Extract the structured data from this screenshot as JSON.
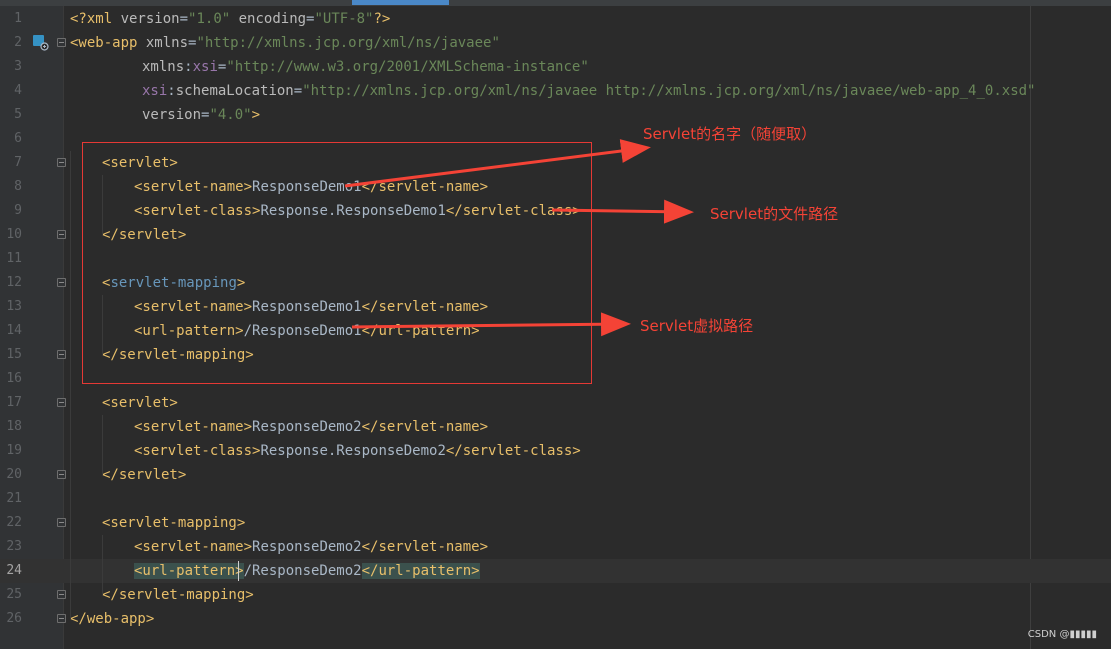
{
  "editor": {
    "current_line": 24,
    "lines": [
      {
        "n": "1",
        "tokens": [
          {
            "c": "t-tag",
            "t": "<?xml "
          },
          {
            "c": "t-attr",
            "t": "version"
          },
          {
            "c": "t-txt",
            "t": "="
          },
          {
            "c": "t-val",
            "t": "\"1.0\""
          },
          {
            "c": "t-attr",
            "t": " encoding"
          },
          {
            "c": "t-txt",
            "t": "="
          },
          {
            "c": "t-val",
            "t": "\"UTF-8\""
          },
          {
            "c": "t-tag",
            "t": "?>"
          }
        ]
      },
      {
        "n": "2",
        "tokens": [
          {
            "c": "t-tag",
            "t": "<web-app "
          },
          {
            "c": "t-attr",
            "t": "xmlns"
          },
          {
            "c": "t-txt",
            "t": "="
          },
          {
            "c": "t-val",
            "t": "\"http://xmlns.jcp.org/xml/ns/javaee\""
          }
        ]
      },
      {
        "n": "3",
        "tokens": [
          {
            "c": "t-attr",
            "t": "xmlns"
          },
          {
            "c": "t-txt",
            "t": ":"
          },
          {
            "c": "t-ns",
            "t": "xsi"
          },
          {
            "c": "t-txt",
            "t": "="
          },
          {
            "c": "t-val",
            "t": "\"http://www.w3.org/2001/XMLSchema-instance\""
          }
        ]
      },
      {
        "n": "4",
        "tokens": [
          {
            "c": "t-ns",
            "t": "xsi"
          },
          {
            "c": "t-txt",
            "t": ":"
          },
          {
            "c": "t-attr",
            "t": "schemaLocation"
          },
          {
            "c": "t-txt",
            "t": "="
          },
          {
            "c": "t-val",
            "t": "\"http://xmlns.jcp.org/xml/ns/javaee http://xmlns.jcp.org/xml/ns/javaee/web-app_4_0.xsd\""
          }
        ]
      },
      {
        "n": "5",
        "tokens": [
          {
            "c": "t-attr",
            "t": "version"
          },
          {
            "c": "t-txt",
            "t": "="
          },
          {
            "c": "t-val",
            "t": "\"4.0\""
          },
          {
            "c": "t-tag",
            "t": ">"
          }
        ]
      },
      {
        "n": "6",
        "tokens": []
      },
      {
        "n": "7",
        "tokens": [
          {
            "c": "t-tag",
            "t": "<servlet>"
          }
        ]
      },
      {
        "n": "8",
        "tokens": [
          {
            "c": "t-tag",
            "t": "<servlet-name>"
          },
          {
            "c": "t-txt",
            "t": "ResponseDemo1"
          },
          {
            "c": "t-tag",
            "t": "</servlet-name>"
          }
        ]
      },
      {
        "n": "9",
        "tokens": [
          {
            "c": "t-tag",
            "t": "<servlet-class>"
          },
          {
            "c": "t-txt",
            "t": "Response.ResponseDemo1"
          },
          {
            "c": "t-tag",
            "t": "</servlet-class>"
          }
        ]
      },
      {
        "n": "10",
        "tokens": [
          {
            "c": "t-tag",
            "t": "</servlet>"
          }
        ]
      },
      {
        "n": "11",
        "tokens": []
      },
      {
        "n": "12",
        "tokens": [
          {
            "c": "t-tag",
            "t": "<"
          },
          {
            "c": "t-blue",
            "t": "servlet-mapping"
          },
          {
            "c": "t-tag",
            "t": ">"
          }
        ]
      },
      {
        "n": "13",
        "tokens": [
          {
            "c": "t-tag",
            "t": "<servlet-name>"
          },
          {
            "c": "t-txt",
            "t": "ResponseDemo1"
          },
          {
            "c": "t-tag",
            "t": "</servlet-name>"
          }
        ]
      },
      {
        "n": "14",
        "tokens": [
          {
            "c": "t-tag",
            "t": "<url-pattern>"
          },
          {
            "c": "t-txt",
            "t": "/ResponseDemo1"
          },
          {
            "c": "t-tag",
            "t": "</url-pattern>"
          }
        ]
      },
      {
        "n": "15",
        "tokens": [
          {
            "c": "t-tag",
            "t": "</servlet-mapping>"
          }
        ]
      },
      {
        "n": "16",
        "tokens": []
      },
      {
        "n": "17",
        "tokens": [
          {
            "c": "t-tag",
            "t": "<servlet>"
          }
        ]
      },
      {
        "n": "18",
        "tokens": [
          {
            "c": "t-tag",
            "t": "<servlet-name>"
          },
          {
            "c": "t-txt",
            "t": "ResponseDemo2"
          },
          {
            "c": "t-tag",
            "t": "</servlet-name>"
          }
        ]
      },
      {
        "n": "19",
        "tokens": [
          {
            "c": "t-tag",
            "t": "<servlet-class>"
          },
          {
            "c": "t-txt",
            "t": "Response.ResponseDemo2"
          },
          {
            "c": "t-tag",
            "t": "</servlet-class>"
          }
        ]
      },
      {
        "n": "20",
        "tokens": [
          {
            "c": "t-tag",
            "t": "</servlet>"
          }
        ]
      },
      {
        "n": "21",
        "tokens": []
      },
      {
        "n": "22",
        "tokens": [
          {
            "c": "t-tag",
            "t": "<servlet-mapping>"
          }
        ]
      },
      {
        "n": "23",
        "tokens": [
          {
            "c": "t-tag",
            "t": "<servlet-name>"
          },
          {
            "c": "t-txt",
            "t": "ResponseDemo2"
          },
          {
            "c": "t-tag",
            "t": "</servlet-name>"
          }
        ]
      },
      {
        "n": "24",
        "tokens": [
          {
            "c": "t-tag hl",
            "t": "<url-pattern>"
          },
          {
            "c": "t-txt",
            "t": "/ResponseDemo2"
          },
          {
            "c": "t-tag hl",
            "t": "</url-pattern>"
          }
        ]
      },
      {
        "n": "25",
        "tokens": [
          {
            "c": "t-tag",
            "t": "</servlet-mapping>"
          }
        ]
      },
      {
        "n": "26",
        "tokens": [
          {
            "c": "t-tag",
            "t": "</web-app>"
          }
        ]
      }
    ]
  },
  "annotations": {
    "servlet_name_note": "Servlet的名字（随便取）",
    "servlet_class_note": "Servlet的文件路径",
    "url_pattern_note": "Servlet虚拟路径",
    "annotation_color": "#f44336"
  },
  "watermark": "CSDN @▮▮▮▮▮"
}
